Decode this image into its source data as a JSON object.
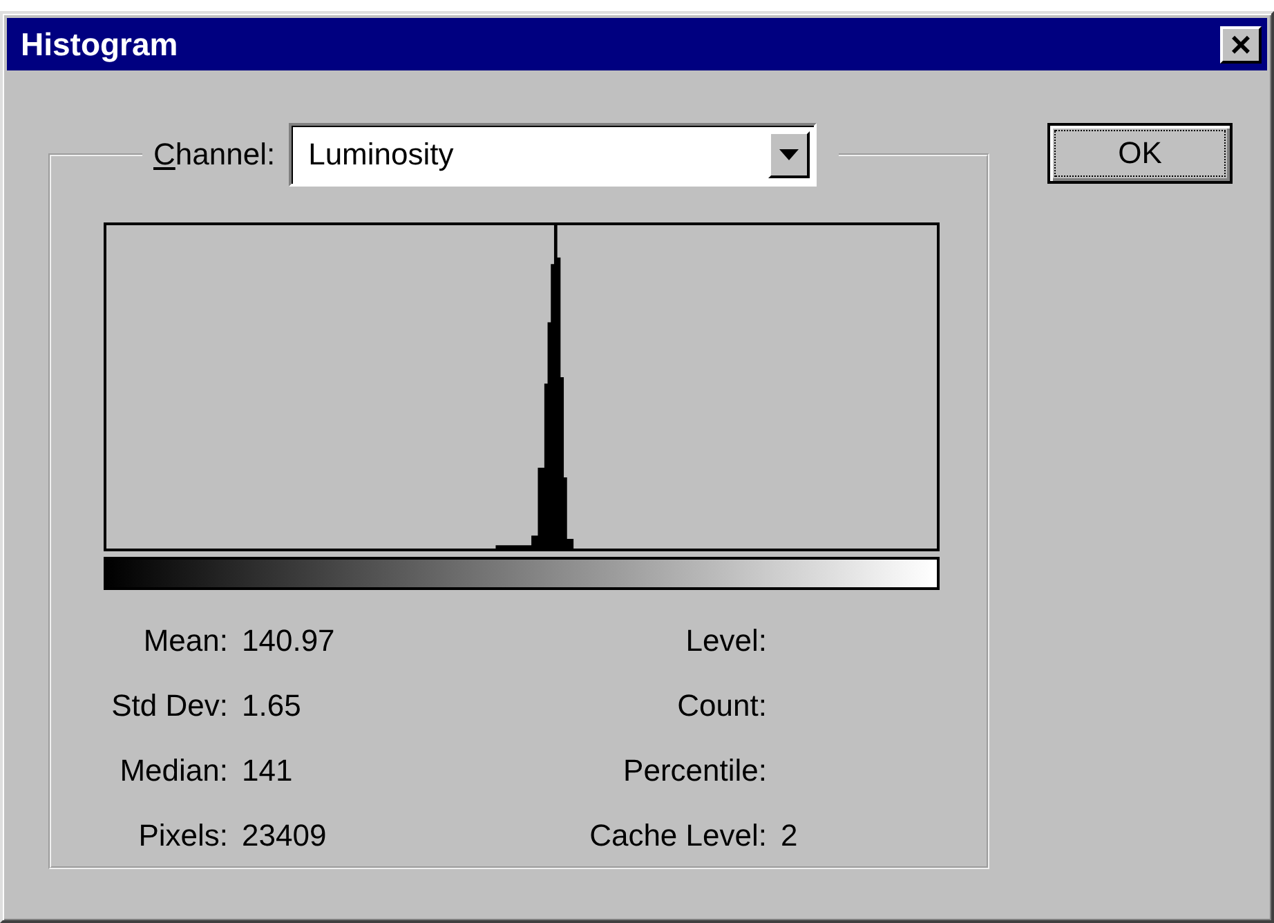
{
  "window": {
    "title": "Histogram",
    "close_label": "×"
  },
  "channel": {
    "label_parts": [
      {
        "text": "C",
        "underlined": true
      },
      {
        "text": "hannel:",
        "underlined": false
      }
    ],
    "value": "Luminosity"
  },
  "stats_left": [
    {
      "label": "Mean:",
      "value": "140.97"
    },
    {
      "label": "Std Dev:",
      "value": "1.65"
    },
    {
      "label": "Median:",
      "value": "141"
    },
    {
      "label": "Pixels:",
      "value": "23409"
    }
  ],
  "stats_right": [
    {
      "label": "Level:"
    },
    {
      "label": "Count:"
    },
    {
      "label": "Percentile:"
    },
    {
      "label": "Cache Level:",
      "value": "2"
    }
  ],
  "ok_button": {
    "label": "OK",
    "focused": true
  }
}
